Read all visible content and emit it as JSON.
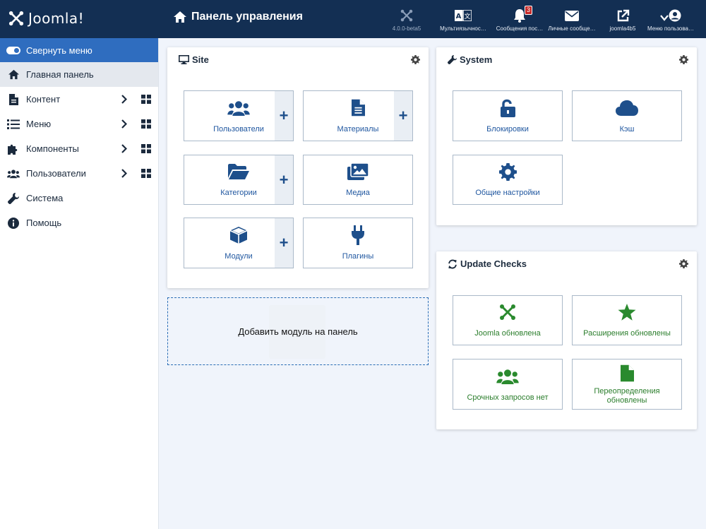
{
  "header": {
    "logo_text": "Joomla!",
    "title": "Панель управления",
    "buttons": [
      {
        "label": "4.0.0-beta5",
        "icon": "joomla-icon"
      },
      {
        "label": "Мультиязычнос…",
        "icon": "language-icon"
      },
      {
        "label": "Сообщения пос…",
        "icon": "bell-icon",
        "badge": "3"
      },
      {
        "label": "Личные сообще…",
        "icon": "envelope-icon"
      },
      {
        "label": "joomla4b5",
        "icon": "external-link-icon"
      },
      {
        "label": "Меню пользова…",
        "icon": "user-icon"
      }
    ]
  },
  "sidebar": {
    "toggle_label": "Свернуть меню",
    "items": [
      {
        "label": "Главная панель",
        "icon": "home-icon"
      },
      {
        "label": "Контент",
        "icon": "file-icon"
      },
      {
        "label": "Меню",
        "icon": "list-icon"
      },
      {
        "label": "Компоненты",
        "icon": "puzzle-icon"
      },
      {
        "label": "Пользователи",
        "icon": "users-icon"
      },
      {
        "label": "Система",
        "icon": "wrench-icon"
      },
      {
        "label": "Помощь",
        "icon": "info-icon"
      }
    ]
  },
  "site": {
    "title": "Site",
    "tiles": [
      {
        "label": "Пользователи",
        "icon": "users-icon",
        "plus": "+"
      },
      {
        "label": "Материалы",
        "icon": "file-text-icon",
        "plus": "+"
      },
      {
        "label": "Категории",
        "icon": "folder-open-icon",
        "plus": "+"
      },
      {
        "label": "Медиа",
        "icon": "images-icon"
      },
      {
        "label": "Модули",
        "icon": "cube-icon",
        "plus": "+"
      },
      {
        "label": "Плагины",
        "icon": "plug-icon"
      }
    ]
  },
  "add_module": {
    "label": "Добавить модуль на панель"
  },
  "system": {
    "title": "System",
    "tiles": [
      {
        "label": "Блокировки",
        "icon": "unlock-icon"
      },
      {
        "label": "Кэш",
        "icon": "cloud-icon"
      },
      {
        "label": "Общие настройки",
        "icon": "gear-icon"
      }
    ]
  },
  "updates": {
    "title": "Update Checks",
    "tiles": [
      {
        "label": "Joomla обновлена",
        "icon": "joomla-icon"
      },
      {
        "label": "Расширения обновлены",
        "icon": "star-icon"
      },
      {
        "label": "Срочных запросов нет",
        "icon": "users-icon"
      },
      {
        "label": "Переопределения обновлены",
        "icon": "file-icon"
      }
    ]
  },
  "colors": {
    "header_bg": "#132f53",
    "accent": "#2f6dbf",
    "tile_text": "#2057a0",
    "success": "#2a7d2b"
  }
}
